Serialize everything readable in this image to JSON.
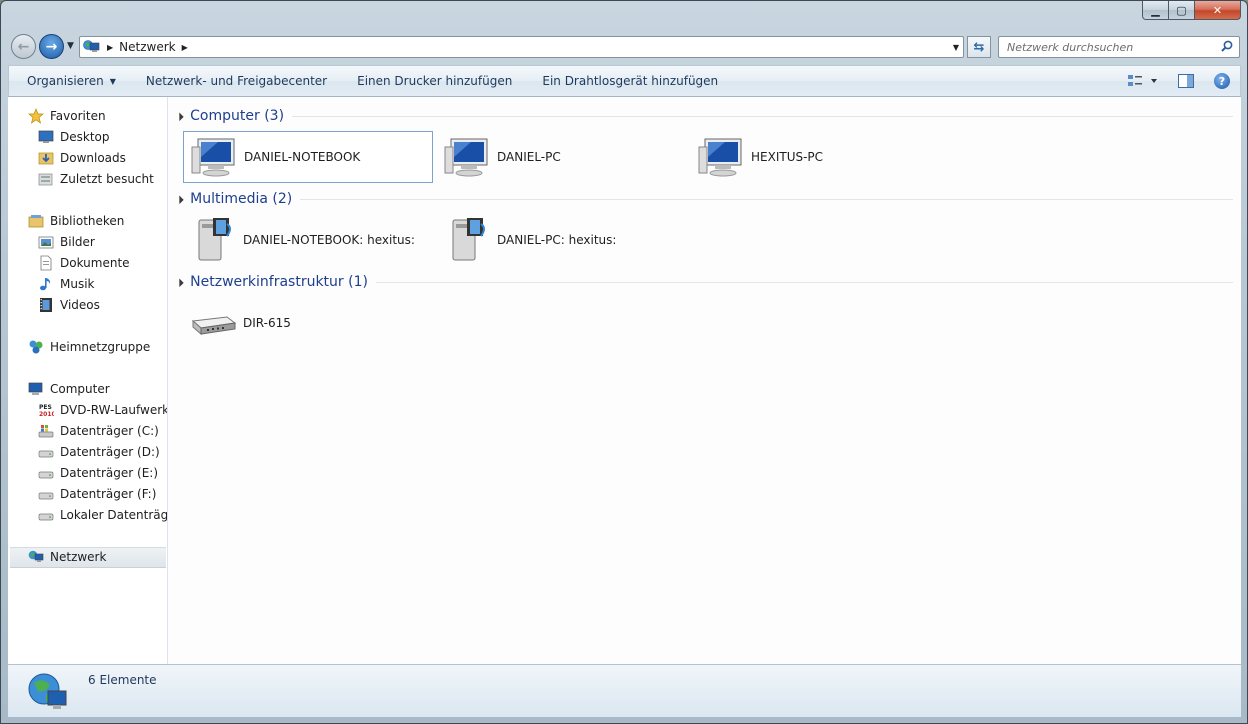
{
  "window": {
    "caption_min": "▁",
    "caption_max": "▢",
    "caption_close": "✕"
  },
  "address": {
    "crumb": "Netzwerk",
    "search_placeholder": "Netzwerk durchsuchen"
  },
  "toolbar": {
    "organize": "Organisieren",
    "network_center": "Netzwerk- und Freigabecenter",
    "add_printer": "Einen Drucker hinzufügen",
    "add_wireless": "Ein Drahtlosgerät hinzufügen",
    "help": "?"
  },
  "sidebar": {
    "favorites": "Favoriten",
    "desktop": "Desktop",
    "downloads": "Downloads",
    "recent": "Zuletzt besucht",
    "libraries": "Bibliotheken",
    "pictures": "Bilder",
    "documents": "Dokumente",
    "music": "Musik",
    "videos": "Videos",
    "homegroup": "Heimnetzgruppe",
    "computer": "Computer",
    "dvd": "DVD-RW-Laufwerk (",
    "drive_c": "Datenträger (C:)",
    "drive_d": "Datenträger (D:)",
    "drive_e": "Datenträger (E:)",
    "drive_f": "Datenträger (F:)",
    "local_drive": "Lokaler Datenträger",
    "network": "Netzwerk"
  },
  "groups": {
    "computer": {
      "title": "Computer (3)",
      "items": [
        "DANIEL-NOTEBOOK",
        "DANIEL-PC",
        "HEXITUS-PC"
      ]
    },
    "multimedia": {
      "title": "Multimedia (2)",
      "items": [
        "DANIEL-NOTEBOOK: hexitus:",
        "DANIEL-PC: hexitus:"
      ]
    },
    "infrastructure": {
      "title": "Netzwerkinfrastruktur (1)",
      "items": [
        "DIR-615"
      ]
    }
  },
  "status": {
    "count": "6 Elemente"
  },
  "colors": {
    "group_title": "#1e3f8e",
    "toolbar_text": "#1e395b",
    "accent_blue": "#1c5ca8"
  }
}
